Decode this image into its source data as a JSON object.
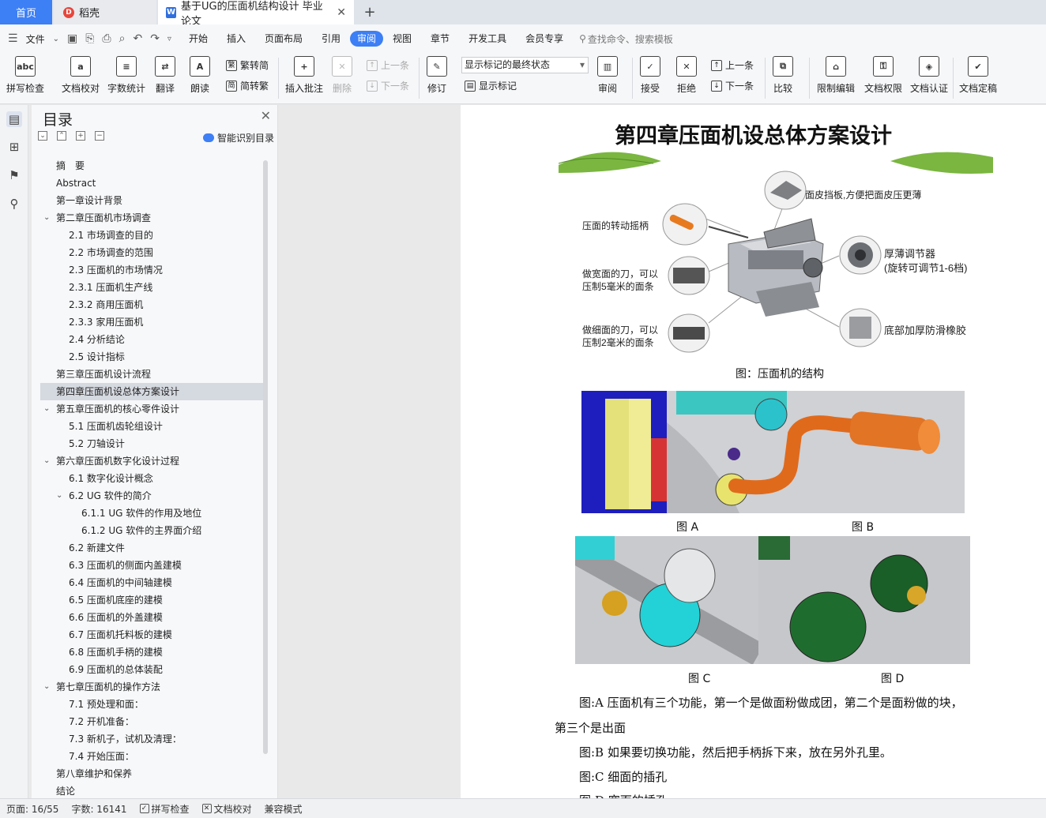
{
  "tabs": {
    "home": "首页",
    "daoke": "稻壳",
    "doc": "基于UG的压面机结构设计 毕业论文",
    "close": "✕",
    "add": "+"
  },
  "menu": {
    "file": "文件",
    "items": [
      "开始",
      "插入",
      "页面布局",
      "引用",
      "审阅",
      "视图",
      "章节",
      "开发工具",
      "会员专享"
    ],
    "active": "审阅",
    "search": "查找命令、搜索模板"
  },
  "ribbon": {
    "spell": "拼写检查",
    "proof": "文档校对",
    "count": "字数统计",
    "translate": "翻译",
    "read": "朗读",
    "to_trad": "繁转简",
    "to_simp": "简转繁",
    "insert_comment": "插入批注",
    "delete": "删除",
    "prev": "上一条",
    "next": "下一条",
    "revise": "修订",
    "markup_select": "显示标记的最终状态",
    "show_markup": "显示标记",
    "review": "审阅",
    "accept": "接受",
    "reject": "拒绝",
    "prev2": "上一条",
    "next2": "下一条",
    "compare": "比较",
    "restrict": "限制编辑",
    "perm": "文档权限",
    "cert": "文档认证",
    "final": "文档定稿"
  },
  "toc": {
    "title": "目录",
    "smart": "智能识别目录",
    "items": [
      {
        "t": "摘　要",
        "lvl": 1
      },
      {
        "t": "Abstract",
        "lvl": 1
      },
      {
        "t": "第一章设计背景",
        "lvl": 1
      },
      {
        "t": "第二章压面机市场调查",
        "lvl": 1,
        "caret": true
      },
      {
        "t": "2.1 市场调查的目的",
        "lvl": 2
      },
      {
        "t": "2.2 市场调查的范围",
        "lvl": 2
      },
      {
        "t": "2.3 压面机的市场情况",
        "lvl": 2
      },
      {
        "t": "2.3.1 压面机生产线",
        "lvl": 2
      },
      {
        "t": "2.3.2 商用压面机",
        "lvl": 2
      },
      {
        "t": "2.3.3 家用压面机",
        "lvl": 2
      },
      {
        "t": "2.4 分析结论",
        "lvl": 2
      },
      {
        "t": "2.5 设计指标",
        "lvl": 2
      },
      {
        "t": "第三章压面机设计流程",
        "lvl": 1
      },
      {
        "t": "第四章压面机设总体方案设计",
        "lvl": 1,
        "selected": true
      },
      {
        "t": "第五章压面机的核心零件设计",
        "lvl": 1,
        "caret": true
      },
      {
        "t": "5.1 压面机齿轮组设计",
        "lvl": 2
      },
      {
        "t": "5.2 刀轴设计",
        "lvl": 2
      },
      {
        "t": "第六章压面机数字化设计过程",
        "lvl": 1,
        "caret": true
      },
      {
        "t": "6.1 数字化设计概念",
        "lvl": 2
      },
      {
        "t": "6.2 UG 软件的简介",
        "lvl": 2,
        "caret": true
      },
      {
        "t": "6.1.1 UG 软件的作用及地位",
        "lvl": 3
      },
      {
        "t": "6.1.2 UG 软件的主界面介绍",
        "lvl": 3
      },
      {
        "t": "6.2  新建文件",
        "lvl": 2
      },
      {
        "t": "6.3  压面机的侧面内盖建模",
        "lvl": 2
      },
      {
        "t": "6.4 压面机的中间轴建模",
        "lvl": 2
      },
      {
        "t": "6.5  压面机底座的建模",
        "lvl": 2
      },
      {
        "t": "6.6  压面机的外盖建模",
        "lvl": 2
      },
      {
        "t": "6.7  压面机托料板的建模",
        "lvl": 2
      },
      {
        "t": "6.8 压面机手柄的建模",
        "lvl": 2
      },
      {
        "t": "6.9 压面机的总体装配",
        "lvl": 2
      },
      {
        "t": "第七章压面机的操作方法",
        "lvl": 1,
        "caret": true
      },
      {
        "t": "7.1 预处理和面：",
        "lvl": 2
      },
      {
        "t": "7.2 开机准备：",
        "lvl": 2
      },
      {
        "t": "7.3 新机子，试机及清理：",
        "lvl": 2
      },
      {
        "t": "7.4 开始压面：",
        "lvl": 2
      },
      {
        "t": "第八章维护和保养",
        "lvl": 1
      },
      {
        "t": "结论",
        "lvl": 1
      }
    ]
  },
  "doc": {
    "heading": "第四章压面机设总体方案设计",
    "fig1": {
      "label_top": "面皮挡板,方便把面皮压更薄",
      "label_handle": "压面的转动摇柄",
      "label_wide1": "做宽面的刀，可以",
      "label_wide2": "压制5毫米的面条",
      "label_thin1": "做细面的刀，可以",
      "label_thin2": "压制2毫米的面条",
      "label_adj1": "厚薄调节器",
      "label_adj2": "(旋转可调节1-6档)",
      "label_base": "底部加厚防滑橡胶"
    },
    "fig1_caption": "图：压面机的结构",
    "capA": "图 A",
    "capB": "图 B",
    "capC": "图 C",
    "capD": "图 D",
    "p1a": "图:A 压面机有三个功能，第一个是做面粉做成团，第二个是面粉做的块，",
    "p1b": "第三个是出面",
    "p2": "图:B 如果要切换功能，然后把手柄拆下来，放在另外孔里。",
    "p3": "图:C  细面的插孔",
    "p4": "图:D  宽面的插孔"
  },
  "status": {
    "page": "页面: 16/55",
    "words": "字数: 16141",
    "spell": "拼写检查",
    "proof": "文档校对",
    "compat": "兼容模式"
  }
}
